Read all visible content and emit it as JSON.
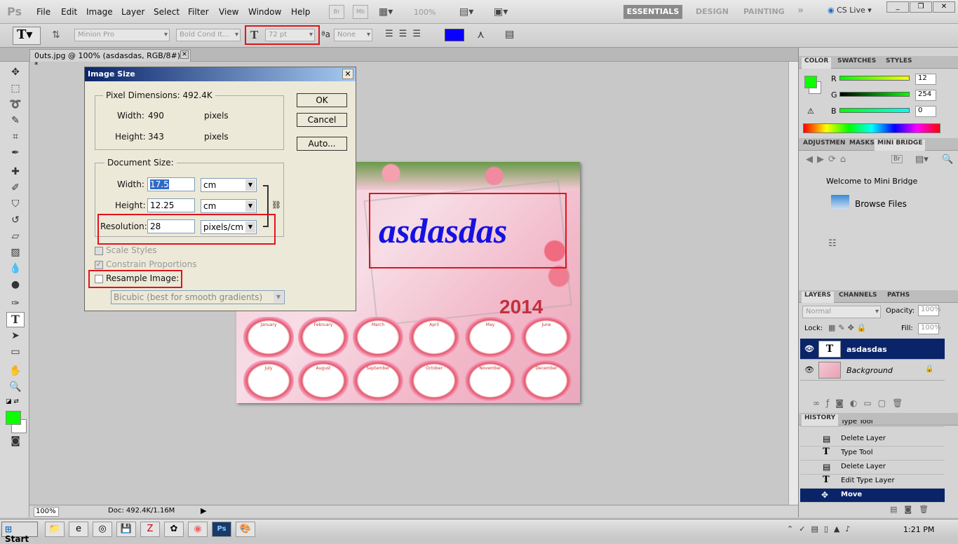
{
  "menubar": {
    "logo": "Ps",
    "items": [
      "File",
      "Edit",
      "Image",
      "Layer",
      "Select",
      "Filter",
      "View",
      "Window",
      "Help"
    ],
    "br_label": "Br",
    "mb_label": "Mb",
    "zoom": "100%",
    "workspaces": {
      "essentials": "ESSENTIALS",
      "design": "DESIGN",
      "painting": "PAINTING",
      "more": "»"
    },
    "cslive": "CS Live",
    "cslive_dropdown": "▾"
  },
  "options": {
    "font_family": "Minion Pro",
    "font_style": "Bold Cond It...",
    "font_size": "72 pt",
    "aa_label": "ªa",
    "antialias": "None",
    "text_color": "#0a00ff"
  },
  "document": {
    "tab_title": "0uts.jpg @ 100% (asdasdas, RGB/8#) *",
    "canvas_text": "asdasdas",
    "year": "2014",
    "months": [
      "January",
      "February",
      "March",
      "April",
      "May",
      "June",
      "July",
      "August",
      "September",
      "October",
      "November",
      "December"
    ]
  },
  "status": {
    "zoom": "100%",
    "doc": "Doc: 492.4K/1.16M"
  },
  "dialog": {
    "title": "Image Size",
    "pixel_dimensions_label": "Pixel Dimensions:",
    "pixel_dimensions_value": "492.4K",
    "width_label": "Width:",
    "width_px": "490",
    "height_label": "Height:",
    "height_px": "343",
    "pixels_unit": "pixels",
    "document_size_label": "Document Size:",
    "doc_width": "17.5",
    "doc_height": "12.25",
    "resolution_label": "Resolution:",
    "resolution": "28",
    "unit_cm": "cm",
    "unit_res": "pixels/cm",
    "scale_styles": "Scale Styles",
    "constrain": "Constrain Proportions",
    "resample": "Resample Image:",
    "resample_method": "Bicubic (best for smooth gradients)",
    "ok": "OK",
    "cancel": "Cancel",
    "auto": "Auto..."
  },
  "color_panel": {
    "tabs": [
      "COLOR",
      "SWATCHES",
      "STYLES"
    ],
    "r_label": "R",
    "r": "12",
    "g_label": "G",
    "g": "254",
    "b_label": "B",
    "b": "0",
    "foreground": "#0cfe00"
  },
  "bridge_panel": {
    "tabs": [
      "ADJUSTMEN",
      "MASKS",
      "MINI BRIDGE"
    ],
    "welcome": "Welcome to Mini Bridge",
    "browse": "Browse Files",
    "br_label": "Br"
  },
  "layers_panel": {
    "tabs": [
      "LAYERS",
      "CHANNELS",
      "PATHS"
    ],
    "blend_mode": "Normal",
    "opacity_label": "Opacity:",
    "opacity": "100%",
    "lock_label": "Lock:",
    "fill_label": "Fill:",
    "fill": "100%",
    "layers": [
      {
        "name": "asdasdas",
        "thumb": "T",
        "selected": true
      },
      {
        "name": "Background",
        "selected": false
      }
    ]
  },
  "history_panel": {
    "title": "HISTORY",
    "items": [
      {
        "label": "Type Tool"
      },
      {
        "label": "Delete Layer"
      },
      {
        "label": "Type Tool"
      },
      {
        "label": "Delete Layer"
      },
      {
        "label": "Edit Type Layer"
      },
      {
        "label": "Move"
      }
    ]
  },
  "taskbar": {
    "start": "Start",
    "time": "1:21 PM"
  }
}
